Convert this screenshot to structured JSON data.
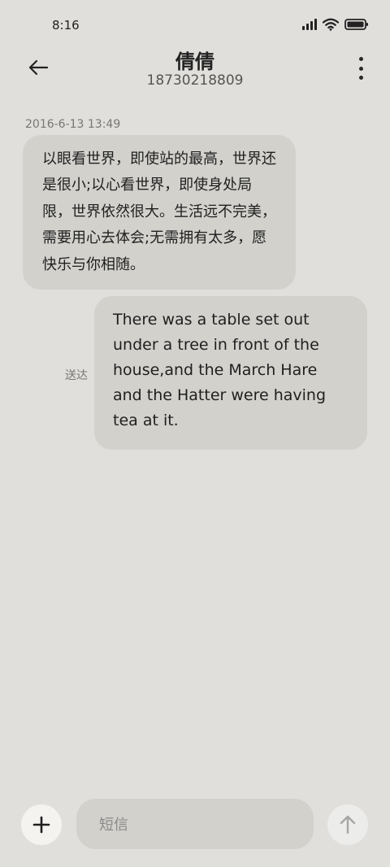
{
  "status_bar": {
    "time": "8:16",
    "icons": [
      "signal-icon",
      "wifi-icon",
      "battery-icon"
    ]
  },
  "header": {
    "back_icon": "arrow-left-icon",
    "contact_name": "倩倩",
    "phone_number": "18730218809",
    "more_icon": "more-vertical-icon"
  },
  "conversation": {
    "timestamp": "2016-6-13 13:49",
    "messages": [
      {
        "direction": "incoming",
        "text": "以眼看世界，即使站的最高，世界还是很小;以心看世界，即使身处局限，世界依然很大。生活远不完美，需要用心去体会;无需拥有太多，愿快乐与你相随。"
      },
      {
        "direction": "outgoing",
        "text": "There was a table set out under a tree in front of the house,and the March Hare and the Hatter were having tea at it.",
        "status": "送达"
      }
    ]
  },
  "composer": {
    "add_icon": "plus-icon",
    "placeholder": "短信",
    "send_icon": "arrow-up-icon"
  },
  "colors": {
    "background": "#e0dfdb",
    "bubble": "#d2d1cc",
    "text": "#1f1f1f"
  }
}
